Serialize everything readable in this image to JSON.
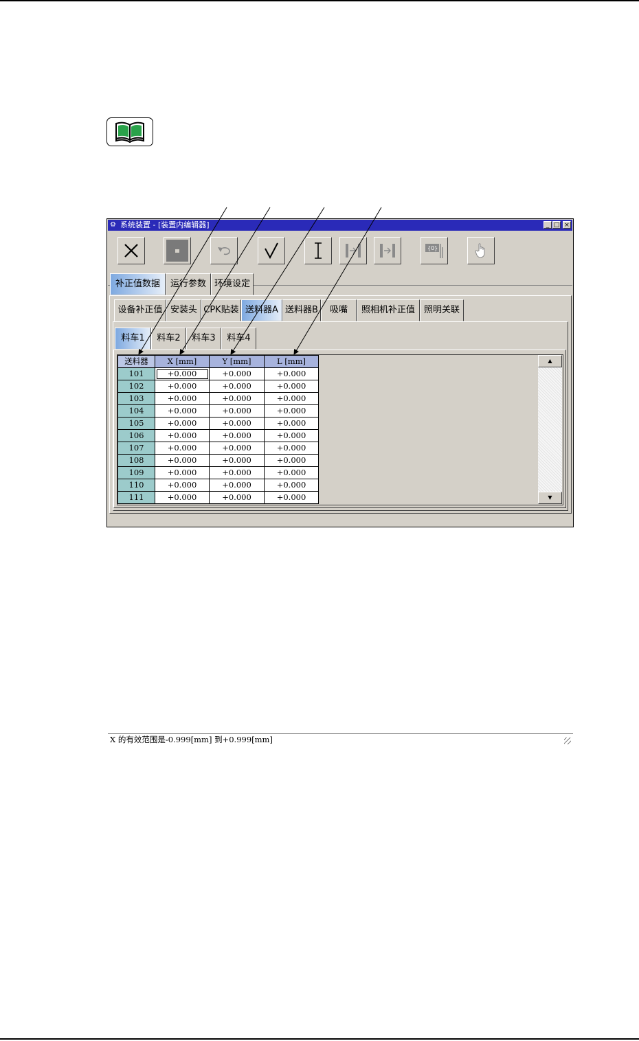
{
  "window": {
    "title": "系统装置 - [装置内编辑器]",
    "app_icon": "robot-icon",
    "minimize_label": "_",
    "maximize_label": "□",
    "close_label": "×"
  },
  "toolbar": [
    {
      "name": "close-tool",
      "icon": "x-icon",
      "enabled": true
    },
    {
      "name": "stop-tool",
      "icon": "square-icon",
      "enabled": true
    },
    {
      "name": "undo-tool",
      "icon": "undo-icon",
      "enabled": false
    },
    {
      "name": "confirm-tool",
      "icon": "check-icon",
      "enabled": true
    },
    {
      "name": "cursor-tool",
      "icon": "text-cursor-icon",
      "enabled": true
    },
    {
      "name": "move-to-tool",
      "icon": "arrow-to-bar-icon",
      "enabled": false
    },
    {
      "name": "move-to-end-tool",
      "icon": "arrow-to-bar-icon",
      "enabled": false
    },
    {
      "name": "offset-tool",
      "icon": "offset-icon",
      "enabled": false
    },
    {
      "name": "teach-tool",
      "icon": "hand-icon",
      "enabled": false
    }
  ],
  "tabs_level1": [
    {
      "label": "补正值数据",
      "active": true
    },
    {
      "label": "运行参数",
      "active": false
    },
    {
      "label": "环境设定",
      "active": false
    }
  ],
  "tabs_level2": [
    {
      "label": "设备补正值",
      "active": false
    },
    {
      "label": "安装头",
      "active": false
    },
    {
      "label": "CPK贴装",
      "active": false
    },
    {
      "label": "送料器A",
      "active": true
    },
    {
      "label": "送料器B",
      "active": false
    },
    {
      "label": "吸嘴",
      "active": false
    },
    {
      "label": "照相机补正值",
      "active": false
    },
    {
      "label": "照明关联",
      "active": false
    }
  ],
  "tabs_level3": [
    {
      "label": "料车1",
      "active": true
    },
    {
      "label": "料车2",
      "active": false
    },
    {
      "label": "料车3",
      "active": false
    },
    {
      "label": "料车4",
      "active": false
    }
  ],
  "grid": {
    "columns": [
      "送料器",
      "X [mm]",
      "Y [mm]",
      "L [mm]"
    ],
    "rows": [
      [
        "101",
        "+0.000",
        "+0.000",
        "+0.000"
      ],
      [
        "102",
        "+0.000",
        "+0.000",
        "+0.000"
      ],
      [
        "103",
        "+0.000",
        "+0.000",
        "+0.000"
      ],
      [
        "104",
        "+0.000",
        "+0.000",
        "+0.000"
      ],
      [
        "105",
        "+0.000",
        "+0.000",
        "+0.000"
      ],
      [
        "106",
        "+0.000",
        "+0.000",
        "+0.000"
      ],
      [
        "107",
        "+0.000",
        "+0.000",
        "+0.000"
      ],
      [
        "108",
        "+0.000",
        "+0.000",
        "+0.000"
      ],
      [
        "109",
        "+0.000",
        "+0.000",
        "+0.000"
      ],
      [
        "110",
        "+0.000",
        "+0.000",
        "+0.000"
      ],
      [
        "111",
        "+0.000",
        "+0.000",
        "+0.000"
      ]
    ],
    "selected_cell": [
      0,
      1
    ]
  },
  "status": "X 的有效范围是-0.999[mm] 到+0.999[mm]",
  "scroll": {
    "up_label": "▲",
    "down_label": "▼"
  }
}
